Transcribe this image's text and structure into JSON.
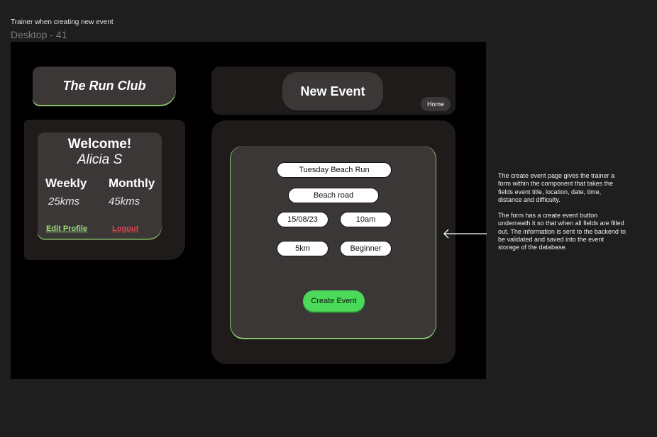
{
  "caption": "Trainer when creating new event",
  "frame_label": "Desktop - 41",
  "logo": {
    "text": "The Run Club"
  },
  "profile": {
    "welcome": "Welcome!",
    "name": "Alicia S",
    "weekly_label": "Weekly",
    "weekly_value": "25kms",
    "monthly_label": "Monthly",
    "monthly_value": "45kms",
    "edit_profile": "Edit Profile",
    "logout": "Logout"
  },
  "header": {
    "title": "New Event",
    "home": "Home"
  },
  "form": {
    "title_value": "Tuesday Beach Run",
    "location_value": "Beach road",
    "date_value": "15/08/23",
    "time_value": "10am",
    "distance_value": "5km",
    "difficulty_value": "Beginner",
    "submit_label": "Create Event"
  },
  "notes": {
    "paragraph1": "The create event page gives the trainer a form within the component that takes the fields event title, location, date, time, distance and difficulty.",
    "paragraph2": "The form has a create event button underneath it so that when all fields are filled out. The information is sent to the backend to be validated and saved into the event storage of the database."
  },
  "colors": {
    "accent_green": "#8ac46b",
    "button_green": "#4bd95a",
    "logout_red": "#e0444d",
    "edit_green": "#9fdc7a"
  },
  "icons": {
    "arrow": "arrow-left-icon"
  }
}
